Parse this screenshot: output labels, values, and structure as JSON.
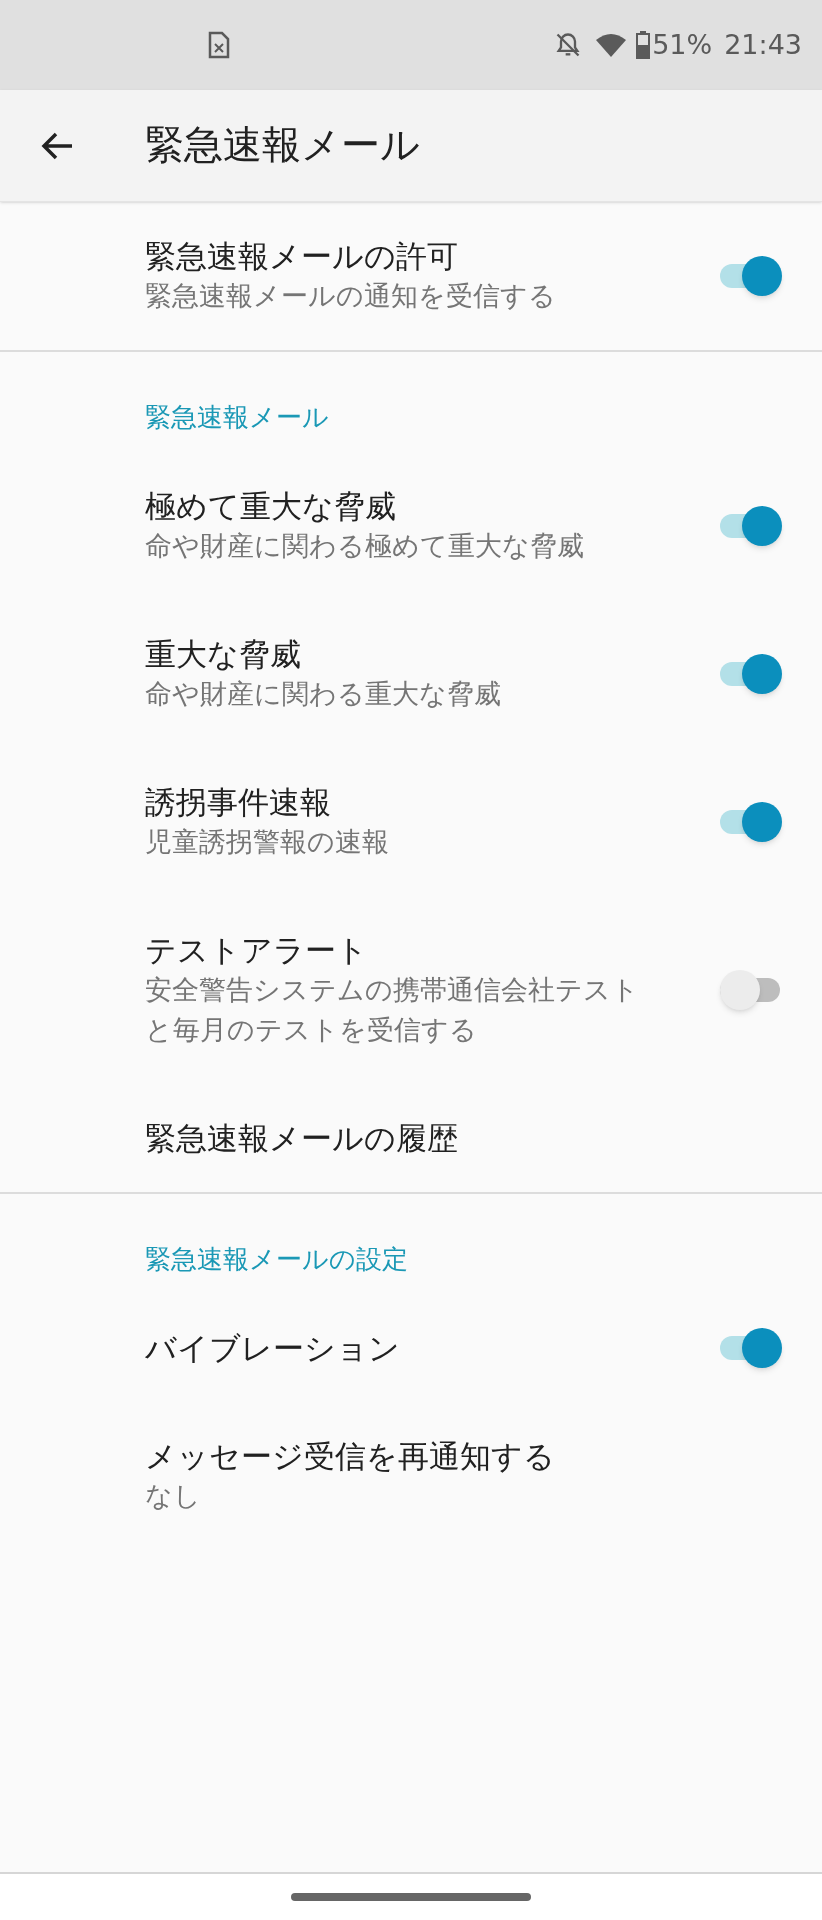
{
  "status_bar": {
    "battery": "51%",
    "time": "21:43"
  },
  "app_bar": {
    "title": "緊急速報メール"
  },
  "sections": [
    {
      "items": [
        {
          "kind": "switch",
          "title": "緊急速報メールの許可",
          "summary": "緊急速報メールの通知を受信する",
          "on": true
        }
      ]
    },
    {
      "title": "緊急速報メール",
      "items": [
        {
          "kind": "switch",
          "title": "極めて重大な脅威",
          "summary": "命や財産に関わる極めて重大な脅威",
          "on": true
        },
        {
          "kind": "switch",
          "title": "重大な脅威",
          "summary": "命や財産に関わる重大な脅威",
          "on": true
        },
        {
          "kind": "switch",
          "title": "誘拐事件速報",
          "summary": "児童誘拐警報の速報",
          "on": true
        },
        {
          "kind": "switch",
          "title": "テストアラート",
          "summary": "安全警告システムの携帯通信会社テストと毎月のテストを受信する",
          "on": false
        },
        {
          "kind": "link",
          "title": "緊急速報メールの履歴"
        }
      ]
    },
    {
      "title": "緊急速報メールの設定",
      "items": [
        {
          "kind": "switch",
          "title": "バイブレーション",
          "on": true
        },
        {
          "kind": "link",
          "title": "メッセージ受信を再通知する",
          "summary": "なし"
        }
      ]
    }
  ]
}
